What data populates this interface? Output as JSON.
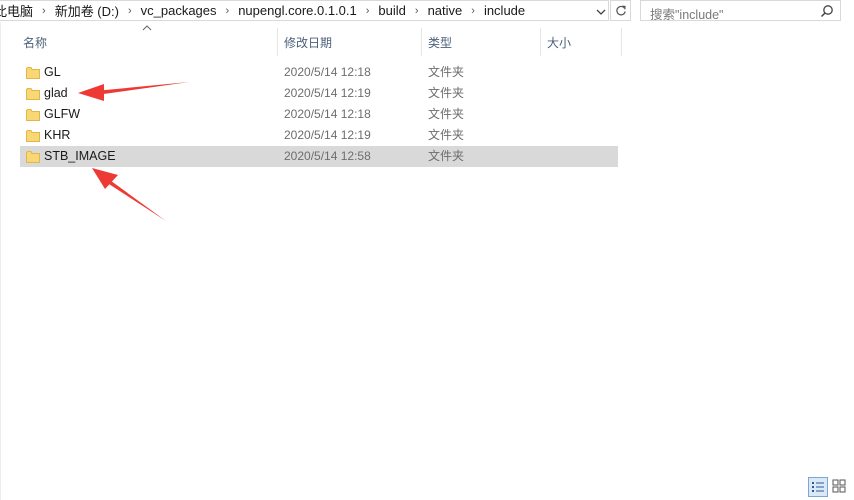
{
  "address": {
    "crumbs": [
      "此电脑",
      "新加卷 (D:)",
      "vc_packages",
      "nupengl.core.0.1.0.1",
      "build",
      "native",
      "include"
    ]
  },
  "search": {
    "placeholder": "搜索\"include\""
  },
  "columns": {
    "name": "名称",
    "date": "修改日期",
    "type": "类型",
    "size": "大小"
  },
  "rows": [
    {
      "name": "GL",
      "date": "2020/5/14 12:18",
      "type": "文件夹",
      "selected": false
    },
    {
      "name": "glad",
      "date": "2020/5/14 12:19",
      "type": "文件夹",
      "selected": false
    },
    {
      "name": "GLFW",
      "date": "2020/5/14 12:18",
      "type": "文件夹",
      "selected": false
    },
    {
      "name": "KHR",
      "date": "2020/5/14 12:19",
      "type": "文件夹",
      "selected": false
    },
    {
      "name": "STB_IMAGE",
      "date": "2020/5/14 12:58",
      "type": "文件夹",
      "selected": true
    }
  ],
  "colors": {
    "folder": "#f8d775",
    "folder_dark": "#e2b64a",
    "annotation_arrow": "#ee3a35",
    "selected_row": "#d9d9d9",
    "header_text": "#4c607a"
  },
  "icons": {
    "folder": "folder-icon",
    "search": "search-icon",
    "refresh": "refresh-icon",
    "dropdown": "chevron-down-icon",
    "sort": "sort-up-icon"
  }
}
